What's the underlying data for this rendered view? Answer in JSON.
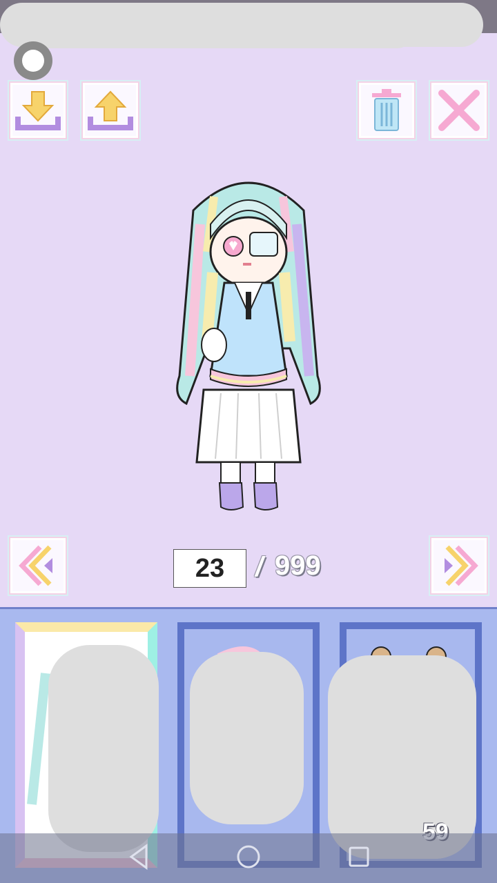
{
  "toolbar": {
    "record_button_icon": "record-icon",
    "download_icon": "download-icon",
    "upload_icon": "upload-icon",
    "delete_icon": "trash-icon",
    "close_icon": "close-icon"
  },
  "pager": {
    "current_page": "23",
    "separator": "/",
    "total_pages": "999",
    "prev_icon": "double-chevron-left-icon",
    "next_icon": "double-chevron-right-icon"
  },
  "tray": {
    "slots": [
      {
        "selected": true
      },
      {
        "selected": false
      },
      {
        "selected": false
      }
    ],
    "visible_price_fragment": "59"
  },
  "navbar": {
    "back_icon": "back-triangle-icon",
    "home_icon": "home-circle-icon",
    "recents_icon": "recents-square-icon"
  },
  "colors": {
    "background": "#e6d9f6",
    "tray": "#a9b9ef",
    "slot_border": "#5d74c8",
    "accent_pink": "#f6a9d2",
    "accent_yellow": "#f7d36b",
    "accent_purple": "#b28de0"
  }
}
